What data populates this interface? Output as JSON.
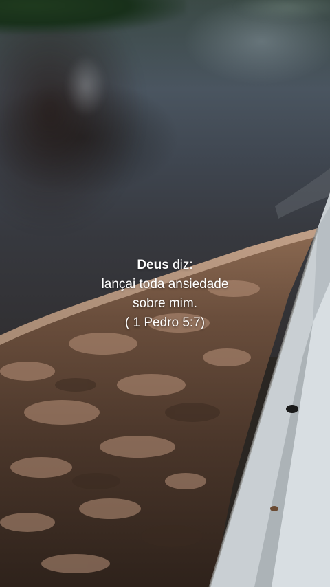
{
  "quote": {
    "speaker": "Deus",
    "verb": " diz:",
    "line2": "lançai toda ansiedade",
    "line3": "sobre mim.",
    "reference": "( 1 Pedro 5:7)"
  }
}
